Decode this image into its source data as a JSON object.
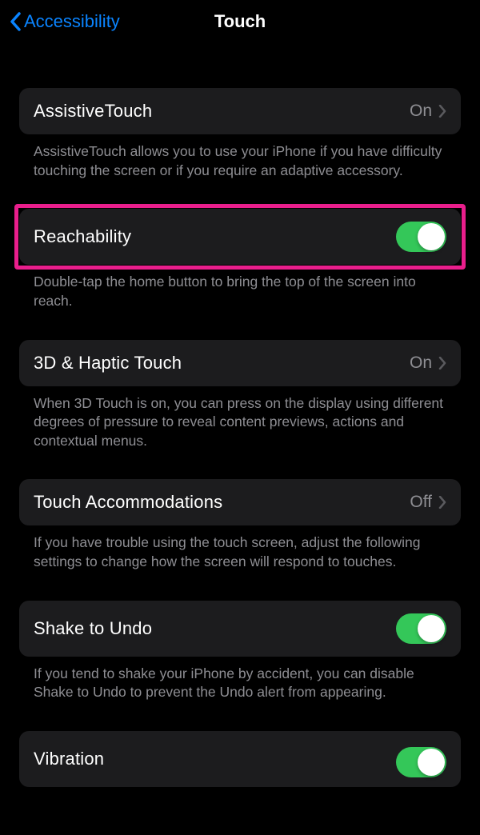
{
  "header": {
    "back_label": "Accessibility",
    "title": "Touch"
  },
  "sections": {
    "assistive_touch": {
      "label": "AssistiveTouch",
      "value": "On",
      "footer": "AssistiveTouch allows you to use your iPhone if you have difficulty touching the screen or if you require an adaptive accessory."
    },
    "reachability": {
      "label": "Reachability",
      "footer": "Double-tap the home button to bring the top of the screen into reach."
    },
    "haptic": {
      "label": "3D & Haptic Touch",
      "value": "On",
      "footer": "When 3D Touch is on, you can press on the display using different degrees of pressure to reveal content previews, actions and contextual menus."
    },
    "accommodations": {
      "label": "Touch Accommodations",
      "value": "Off",
      "footer": "If you have trouble using the touch screen, adjust the following settings to change how the screen will respond to touches."
    },
    "shake": {
      "label": "Shake to Undo",
      "footer": "If you tend to shake your iPhone by accident, you can disable Shake to Undo to prevent the Undo alert from appearing."
    },
    "vibration": {
      "label": "Vibration"
    }
  }
}
